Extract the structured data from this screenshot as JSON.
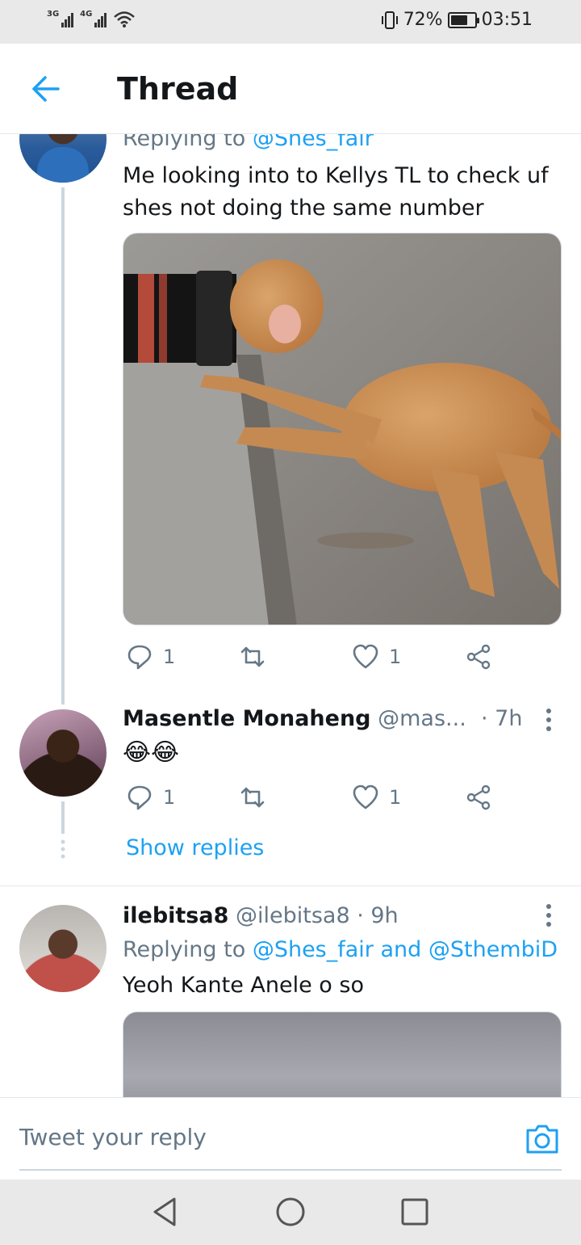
{
  "status_bar": {
    "network1": "3G",
    "network2": "4G",
    "battery_text": "72%",
    "battery_level": 0.72,
    "time": "03:51"
  },
  "header": {
    "title": "Thread",
    "back_icon": "arrow-left-icon"
  },
  "tweets": [
    {
      "replying_label": "Replying to",
      "replying_to": "@Shes_fair",
      "text": "Me looking into to Kellys TL to check uf shes not doing the same number",
      "media_desc": "monkey-camera-photo",
      "reply_count": "1",
      "like_count": "1"
    },
    {
      "name": "Masentle Monaheng",
      "handle": "@mas...",
      "time": "· 7h",
      "text": "😂😂",
      "reply_count": "1",
      "like_count": "1",
      "show_replies": "Show replies"
    },
    {
      "name": "ilebitsa8",
      "handle": "@ilebitsa8",
      "time": "· 9h",
      "replying_label": "Replying to",
      "replying_to": "@Shes_fair and @SthembiD",
      "text": "Yeoh Kante Anele o so"
    }
  ],
  "reply_bar": {
    "placeholder": "Tweet your reply",
    "camera_icon": "camera-icon"
  },
  "colors": {
    "accent": "#1da1f2",
    "secondary_text": "#657786",
    "border": "#e1e8ed"
  }
}
